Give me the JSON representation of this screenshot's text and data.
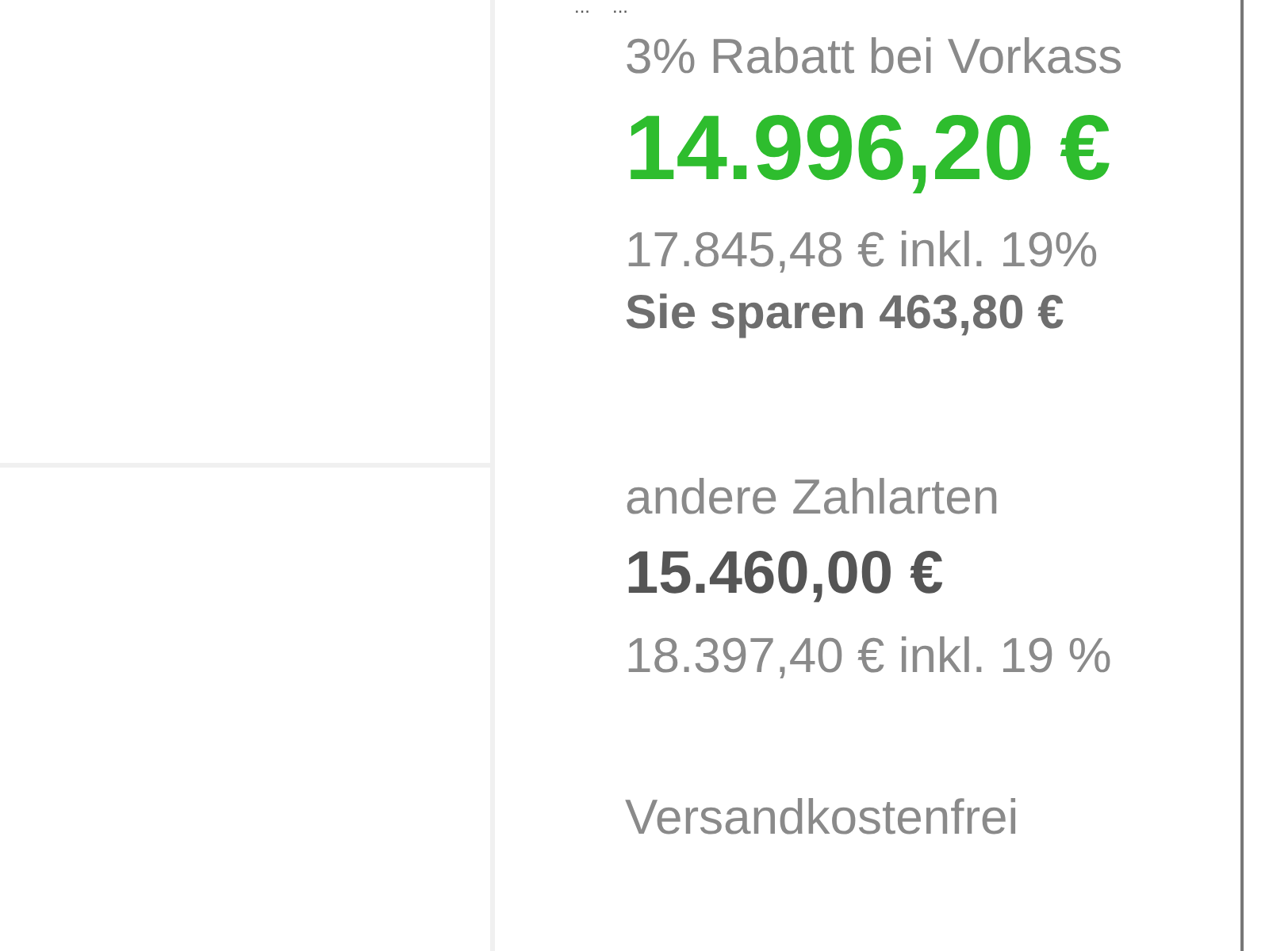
{
  "breadcrumb": [
    "...",
    "..."
  ],
  "prepayment": {
    "label": "3% Rabatt bei Vorkass",
    "price": "14.996,20 €",
    "gross": "17.845,48 € inkl. 19%",
    "savings": "Sie sparen 463,80 €"
  },
  "other_payment": {
    "label": "andere Zahlarten",
    "price": "15.460,00 €",
    "gross": "18.397,40 € inkl. 19 %"
  },
  "shipping": {
    "label": "Versandkostenfrei"
  }
}
